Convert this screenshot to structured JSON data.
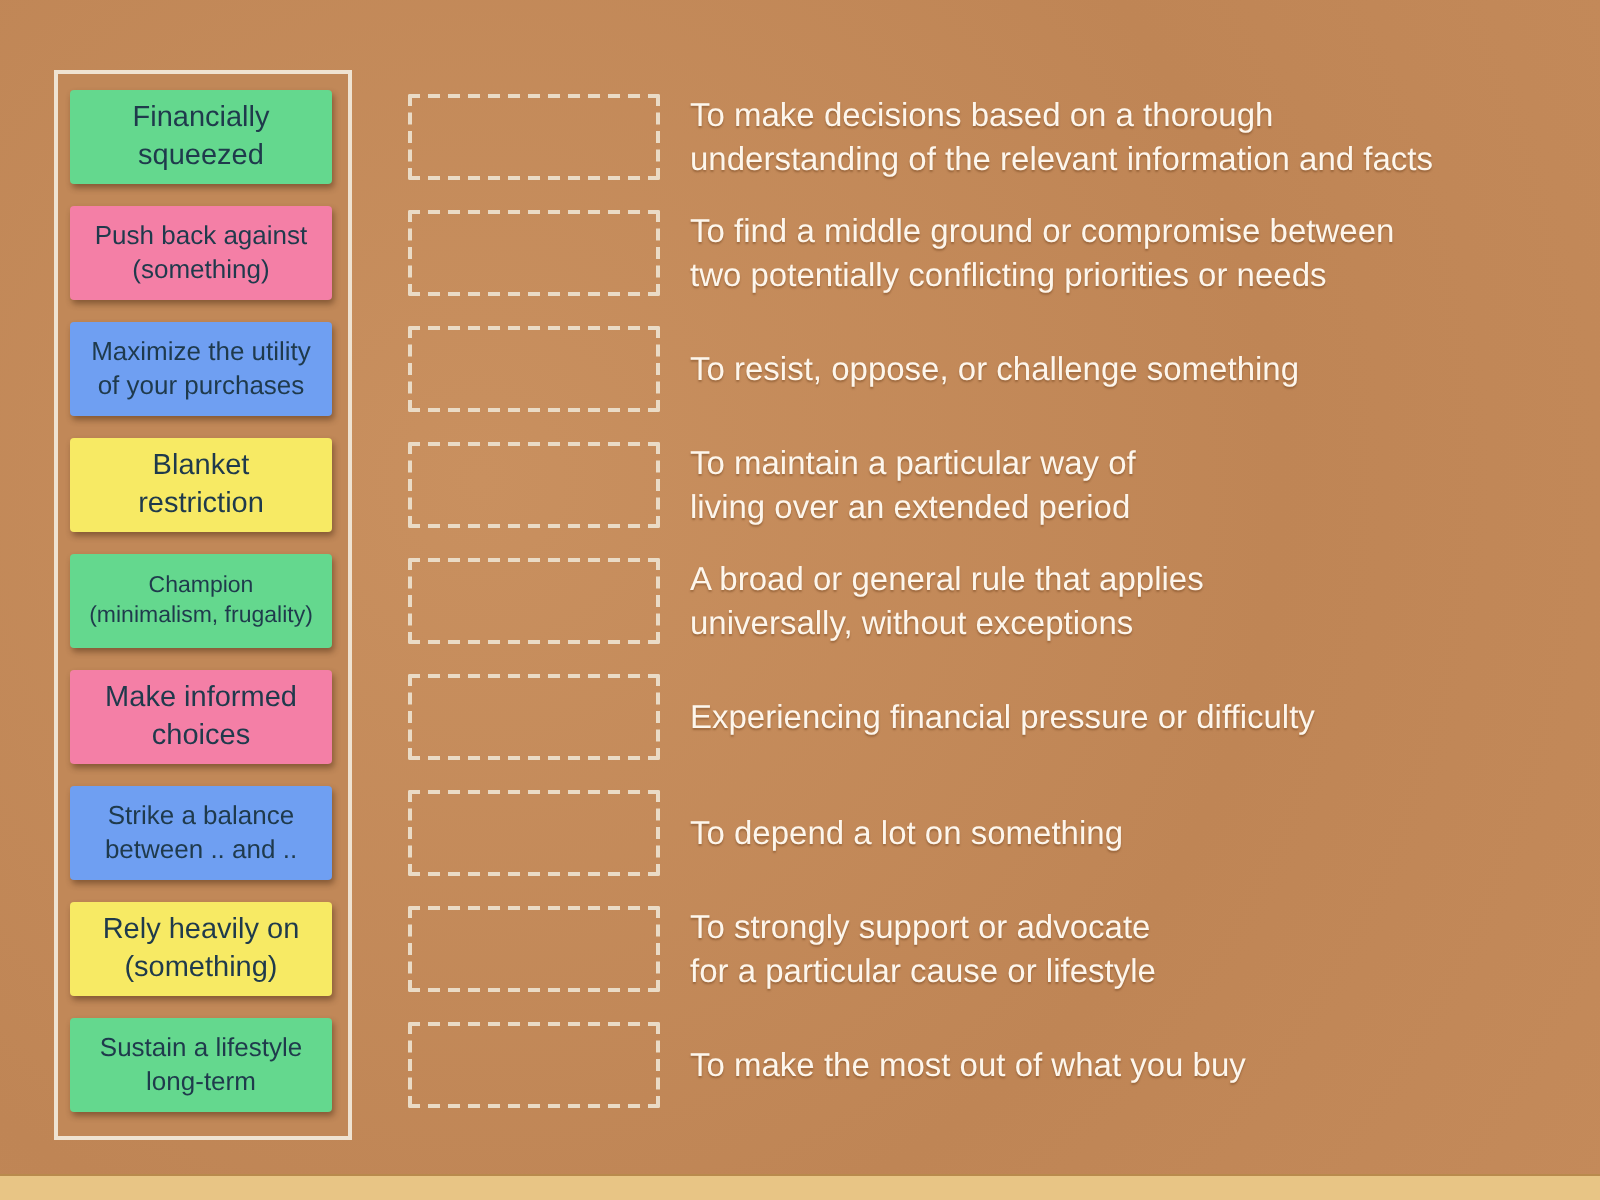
{
  "notes": [
    {
      "text": "Financially\nsqueezed",
      "color": "#64d88e"
    },
    {
      "text": "Push back against\n(something)",
      "color": "#f47fa6"
    },
    {
      "text": "Maximize the utility\nof your purchases",
      "color": "#6f9ff2"
    },
    {
      "text": "Blanket\nrestriction",
      "color": "#f7ea64"
    },
    {
      "text": "Champion\n(minimalism, frugality)",
      "color": "#64d88e"
    },
    {
      "text": "Make informed\nchoices",
      "color": "#f47fa6"
    },
    {
      "text": "Strike a balance\nbetween .. and ..",
      "color": "#6f9ff2"
    },
    {
      "text": "Rely heavily on\n(something)",
      "color": "#f7ea64"
    },
    {
      "text": "Sustain a lifestyle\nlong-term",
      "color": "#64d88e"
    }
  ],
  "rows": [
    {
      "definition": "To make decisions based on a thorough\nunderstanding of the relevant information and facts"
    },
    {
      "definition": "To find a middle ground or compromise between\ntwo potentially conflicting priorities or needs"
    },
    {
      "definition": "To resist, oppose, or challenge something"
    },
    {
      "definition": "To maintain a particular way of\nliving over an extended period"
    },
    {
      "definition": "A broad or general rule that applies\nuniversally, without exceptions"
    },
    {
      "definition": "Experiencing financial pressure or difficulty"
    },
    {
      "definition": "To depend a lot on something"
    },
    {
      "definition": "To strongly support or advocate\nfor a particular cause or lifestyle"
    },
    {
      "definition": "To make the most out of what you buy"
    }
  ]
}
